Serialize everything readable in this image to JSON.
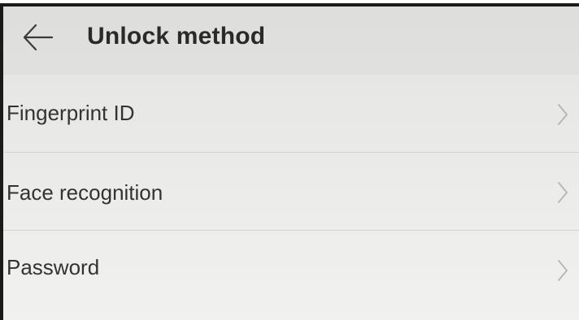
{
  "header": {
    "back_icon": "arrow-left-icon",
    "title": "Unlock method"
  },
  "menu": {
    "items": [
      {
        "label": "Fingerprint ID",
        "icon": "chevron-right-icon"
      },
      {
        "label": "Face recognition",
        "icon": "chevron-right-icon"
      },
      {
        "label": "Password",
        "icon": "chevron-right-icon"
      }
    ]
  },
  "colors": {
    "background": "#ebebea",
    "text": "#333333",
    "chevron": "#b5b5b3",
    "divider": "#d2d2d0"
  }
}
